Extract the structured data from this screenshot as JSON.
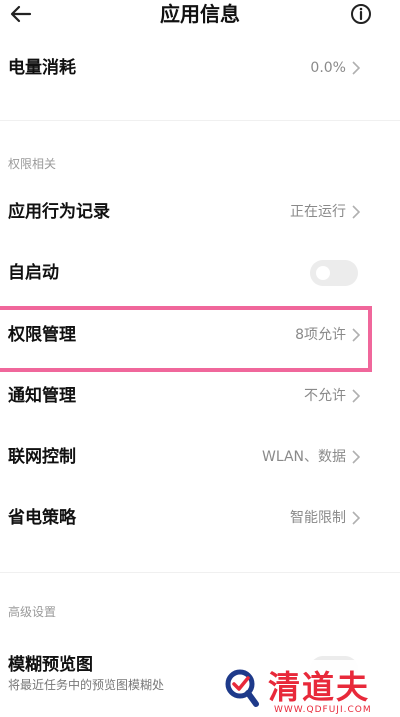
{
  "header": {
    "title": "应用信息",
    "back_icon": "arrow-left-icon",
    "info_icon": "info-circle-icon"
  },
  "battery": {
    "label": "电量消耗",
    "value": "0.0%"
  },
  "permissions_section": {
    "title": "权限相关",
    "items": [
      {
        "label": "应用行为记录",
        "value": "正在运行"
      },
      {
        "label": "自启动",
        "toggle_on": false
      },
      {
        "label": "权限管理",
        "value": "8项允许"
      },
      {
        "label": "通知管理",
        "value": "不允许"
      },
      {
        "label": "联网控制",
        "value": "WLAN、数据"
      },
      {
        "label": "省电策略",
        "value": "智能限制"
      }
    ]
  },
  "advanced_section": {
    "title": "高级设置",
    "blur_preview": {
      "label": "模糊预览图",
      "description": "将最近任务中的预览图模糊处",
      "toggle_on": false
    }
  },
  "watermark": {
    "text": "清道夫",
    "url": "WWW.QDFUJI.COM",
    "color": "#e8293a"
  },
  "colors": {
    "highlight": "#f0679b",
    "value_text": "#8a8a8a"
  }
}
